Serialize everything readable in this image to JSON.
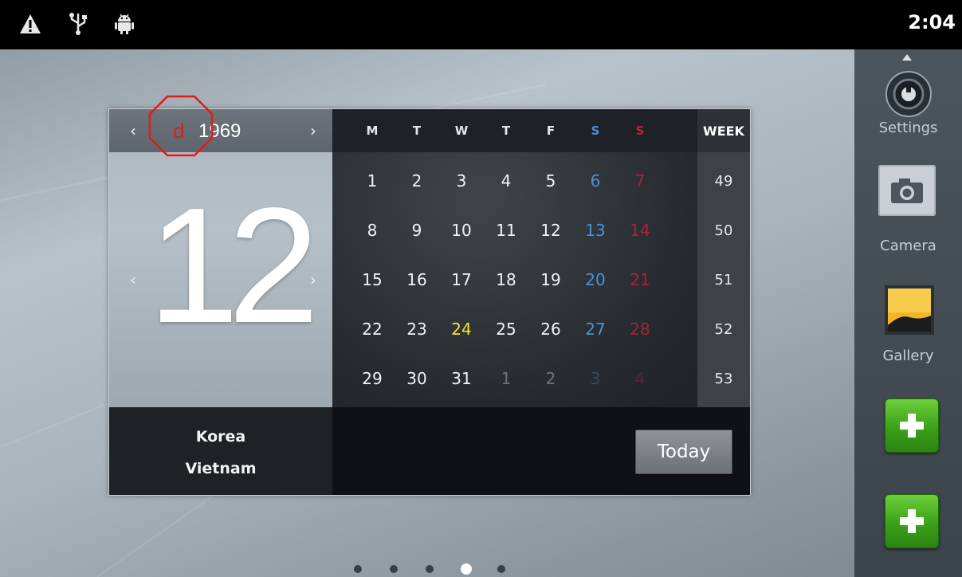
{
  "status_bar": {
    "icons": [
      "warning-icon",
      "usb-icon",
      "android-debug-icon"
    ],
    "time": "2:04"
  },
  "calendar": {
    "year": "1969",
    "month": "12",
    "prev_arrow": "‹",
    "next_arrow": "›",
    "annotation": "d",
    "weekdays": [
      "M",
      "T",
      "W",
      "T",
      "F",
      "S",
      "S"
    ],
    "week_header": "WEEK",
    "weeks": [
      {
        "week": "49",
        "days": [
          "1",
          "2",
          "3",
          "4",
          "5",
          "6",
          "7"
        ]
      },
      {
        "week": "50",
        "days": [
          "8",
          "9",
          "10",
          "11",
          "12",
          "13",
          "14"
        ]
      },
      {
        "week": "51",
        "days": [
          "15",
          "16",
          "17",
          "18",
          "19",
          "20",
          "21"
        ]
      },
      {
        "week": "52",
        "days": [
          "22",
          "23",
          "24",
          "25",
          "26",
          "27",
          "28"
        ]
      },
      {
        "week": "53",
        "days": [
          "29",
          "30",
          "31",
          "1",
          "2",
          "3",
          "4"
        ]
      }
    ],
    "today_day": "24",
    "countries": [
      "Korea",
      "Vietnam"
    ],
    "today_button": "Today"
  },
  "colors": {
    "saturday": "#4a90d9",
    "sunday": "#c0213f",
    "today": "#f3e62a",
    "annotation": "#e21b1b"
  },
  "dock": {
    "items": [
      {
        "label": "Settings",
        "icon": "settings-icon"
      },
      {
        "label": "Camera",
        "icon": "camera-icon"
      },
      {
        "label": "Gallery",
        "icon": "gallery-icon"
      }
    ],
    "add_buttons": [
      "add-shortcut-icon",
      "add-shortcut-icon"
    ]
  },
  "page_indicator": {
    "count": 5,
    "current": 4
  }
}
